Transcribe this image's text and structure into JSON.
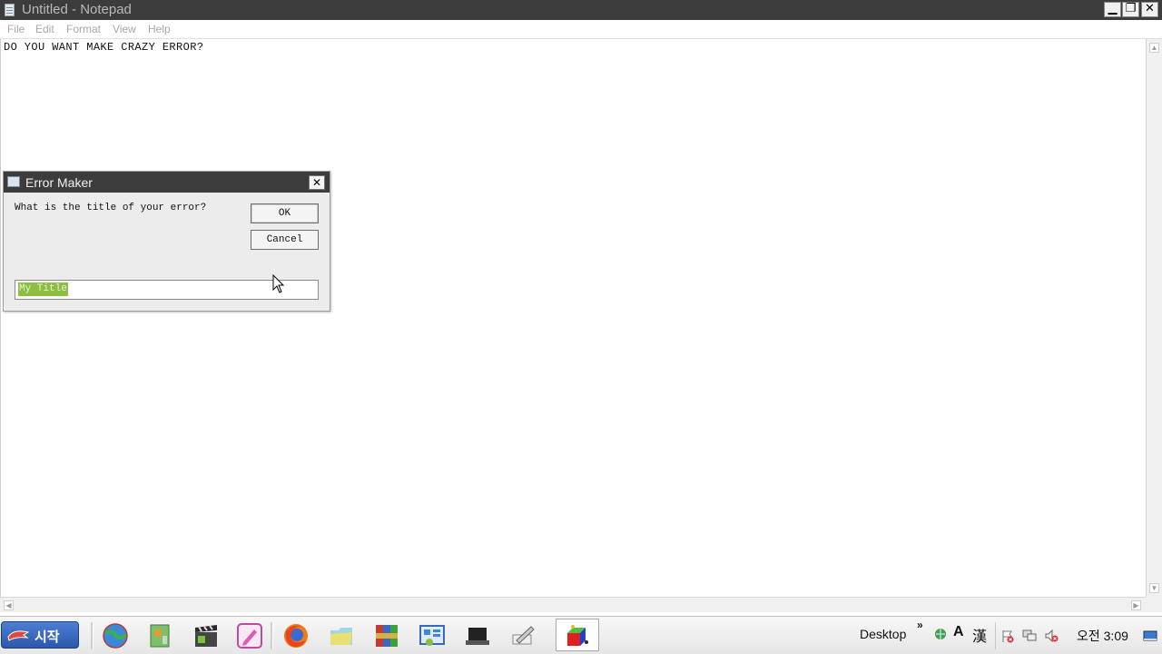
{
  "notepad": {
    "title": "Untitled - Notepad",
    "menu": [
      "File",
      "Edit",
      "Format",
      "View",
      "Help"
    ],
    "content": "DO YOU WANT MAKE CRAZY ERROR?",
    "window_buttons": {
      "minimize": "▁",
      "restore": "❐",
      "close": "✕"
    }
  },
  "dialog": {
    "title": "Error Maker",
    "prompt": "What is the title of your error?",
    "ok_label": "OK",
    "cancel_label": "Cancel",
    "input_value": "My Title",
    "close_glyph": "✕"
  },
  "taskbar": {
    "start_label": "시작",
    "apps": [
      "globe-icon",
      "map-icon",
      "clapper-icon",
      "pen-icon",
      "firefox-icon",
      "folder-icon",
      "winrar-icon",
      "control-panel-icon",
      "laptop-icon",
      "pencil-icon",
      "cube-app-icon"
    ],
    "tray": {
      "toolbar_label": "Desktop",
      "chevron": "»",
      "ime_a": "A",
      "ime_han": "漢",
      "time": "오전 3:09"
    }
  },
  "colors": {
    "titlebar": "#3c3c3c",
    "selection": "#8cbf3f",
    "start_button": "#2c57ad"
  }
}
